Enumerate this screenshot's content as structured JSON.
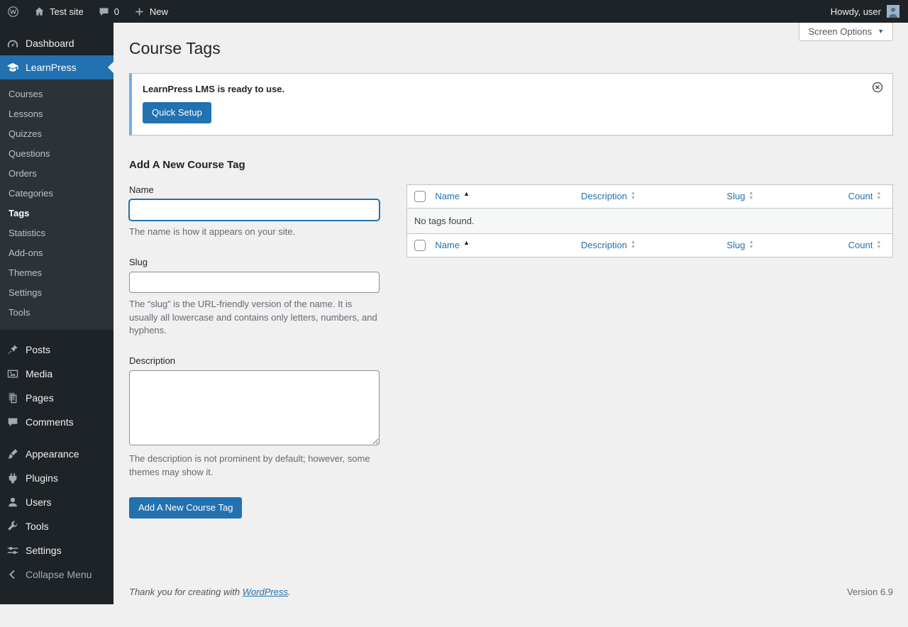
{
  "admin_bar": {
    "site_name": "Test site",
    "comments_count": "0",
    "new_label": "New",
    "howdy_text": "Howdy, user"
  },
  "sidebar": {
    "dashboard": "Dashboard",
    "learnpress": "LearnPress",
    "learnpress_submenu": [
      "Courses",
      "Lessons",
      "Quizzes",
      "Questions",
      "Orders",
      "Categories",
      "Tags",
      "Statistics",
      "Add-ons",
      "Themes",
      "Settings",
      "Tools"
    ],
    "posts": "Posts",
    "media": "Media",
    "pages": "Pages",
    "comments": "Comments",
    "appearance": "Appearance",
    "plugins": "Plugins",
    "users": "Users",
    "tools": "Tools",
    "settings": "Settings",
    "collapse": "Collapse Menu"
  },
  "page": {
    "title": "Course Tags",
    "screen_options_label": "Screen Options"
  },
  "notice": {
    "message": "LearnPress LMS is ready to use.",
    "quick_setup_label": "Quick Setup"
  },
  "form": {
    "heading": "Add A New Course Tag",
    "name_label": "Name",
    "name_help": "The name is how it appears on your site.",
    "slug_label": "Slug",
    "slug_help": "The “slug” is the URL-friendly version of the name. It is usually all lowercase and contains only letters, numbers, and hyphens.",
    "description_label": "Description",
    "description_help": "The description is not prominent by default; however, some themes may show it.",
    "submit_label": "Add A New Course Tag"
  },
  "table": {
    "columns": [
      "Name",
      "Description",
      "Slug",
      "Count"
    ],
    "empty_message": "No tags found."
  },
  "footer": {
    "thanks_prefix": "Thank you for creating with ",
    "wordpress_link_label": "WordPress",
    "thanks_suffix": ".",
    "version": "Version 6.9"
  },
  "icons": {
    "sort_up": "▲",
    "sort_down": "▼",
    "screen_options_arrow": "▼"
  }
}
